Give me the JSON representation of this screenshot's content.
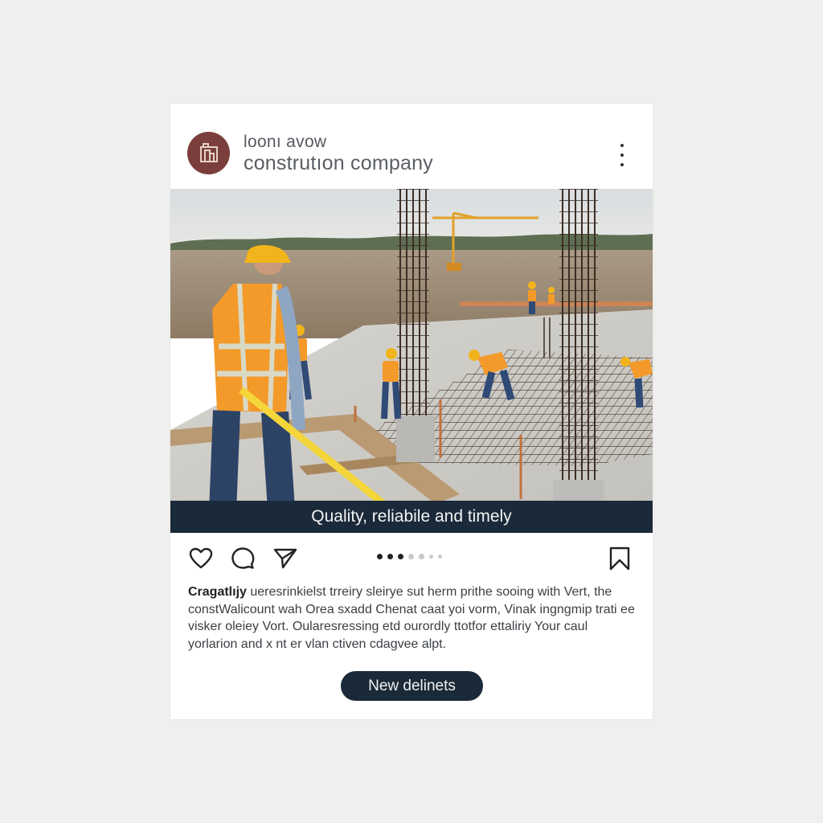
{
  "post": {
    "header": {
      "line1": "loonı avow",
      "line2": "construtıon company"
    },
    "photo_caption": "Quality, reliabile and timely",
    "body": {
      "lead": "Cragatlıjy",
      "text": " ueresrinkielst trreiry sleirye sut herm prithe sooing with Vert, the constWalicount wah Orea sxadd  Chenat caat yoi vorm, Vinak ingngmip trati ee visker oleiey Vort. Oularesressing etd ourordly ttotfor ettaliriy Your caul yorlarion and x nt er vlan ctiven cdagvee alpt."
    },
    "cta_label": "New delinets",
    "carousel": {
      "count": 7,
      "active": 0
    }
  },
  "colors": {
    "avatar": "#7a3f3c",
    "caption_bar": "#1b2a3a",
    "cta": "#1b2a38",
    "vest": "#f39a2a",
    "helmet": "#f2b41c"
  },
  "icons": [
    "building-logo-icon",
    "more-vertical-icon",
    "heart-icon",
    "comment-icon",
    "send-icon",
    "bookmark-icon"
  ]
}
